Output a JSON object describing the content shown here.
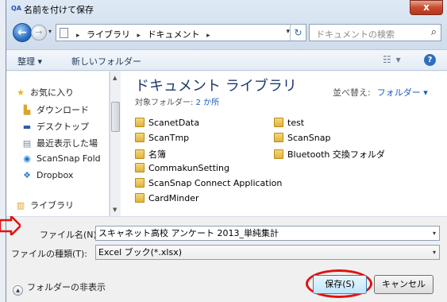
{
  "window": {
    "title": "名前を付けて保存",
    "close_label": "x"
  },
  "address": {
    "crumbs": [
      "ライブラリ",
      "ドキュメント"
    ],
    "search_placeholder": "ドキュメントの検索"
  },
  "toolbar": {
    "organize": "整理 ▾",
    "new_folder": "新しいフォルダー"
  },
  "nav": {
    "items": [
      {
        "label": "お気に入り",
        "icon": "star-icon"
      },
      {
        "label": "ダウンロード",
        "icon": "download-folder-icon"
      },
      {
        "label": "デスクトップ",
        "icon": "desktop-icon"
      },
      {
        "label": "最近表示した場",
        "icon": "recent-places-icon"
      },
      {
        "label": "ScanSnap Fold",
        "icon": "scansnap-icon"
      },
      {
        "label": "Dropbox",
        "icon": "dropbox-icon"
      },
      {
        "label": "ライブラリ",
        "icon": "library-icon"
      }
    ]
  },
  "content": {
    "library_title": "ドキュメント ライブラリ",
    "target_label": "対象フォルダー:",
    "target_value": "2 か所",
    "sort_label": "並べ替え:",
    "sort_value": "フォルダー ▾",
    "folders_col1": [
      "ScanetData",
      "ScanTmp",
      "名簿",
      "CommakunSetting",
      "ScanSnap Connect Application",
      "CardMinder"
    ],
    "folders_col2": [
      "test",
      "ScanSnap",
      "Bluetooth 交換フォルダ"
    ]
  },
  "form": {
    "filename_label": "ファイル名(N):",
    "filename_value": "スキャネット高校 アンケート 2013_単純集計",
    "filetype_label": "ファイルの種類(T):",
    "filetype_value": "Excel ブック(*.xlsx)"
  },
  "footer": {
    "hide_folders": "フォルダーの非表示",
    "save": "保存(S)",
    "cancel": "キャンセル"
  },
  "colors": {
    "annotation_red": "#e01212",
    "accent_blue": "#1c5bbb"
  }
}
